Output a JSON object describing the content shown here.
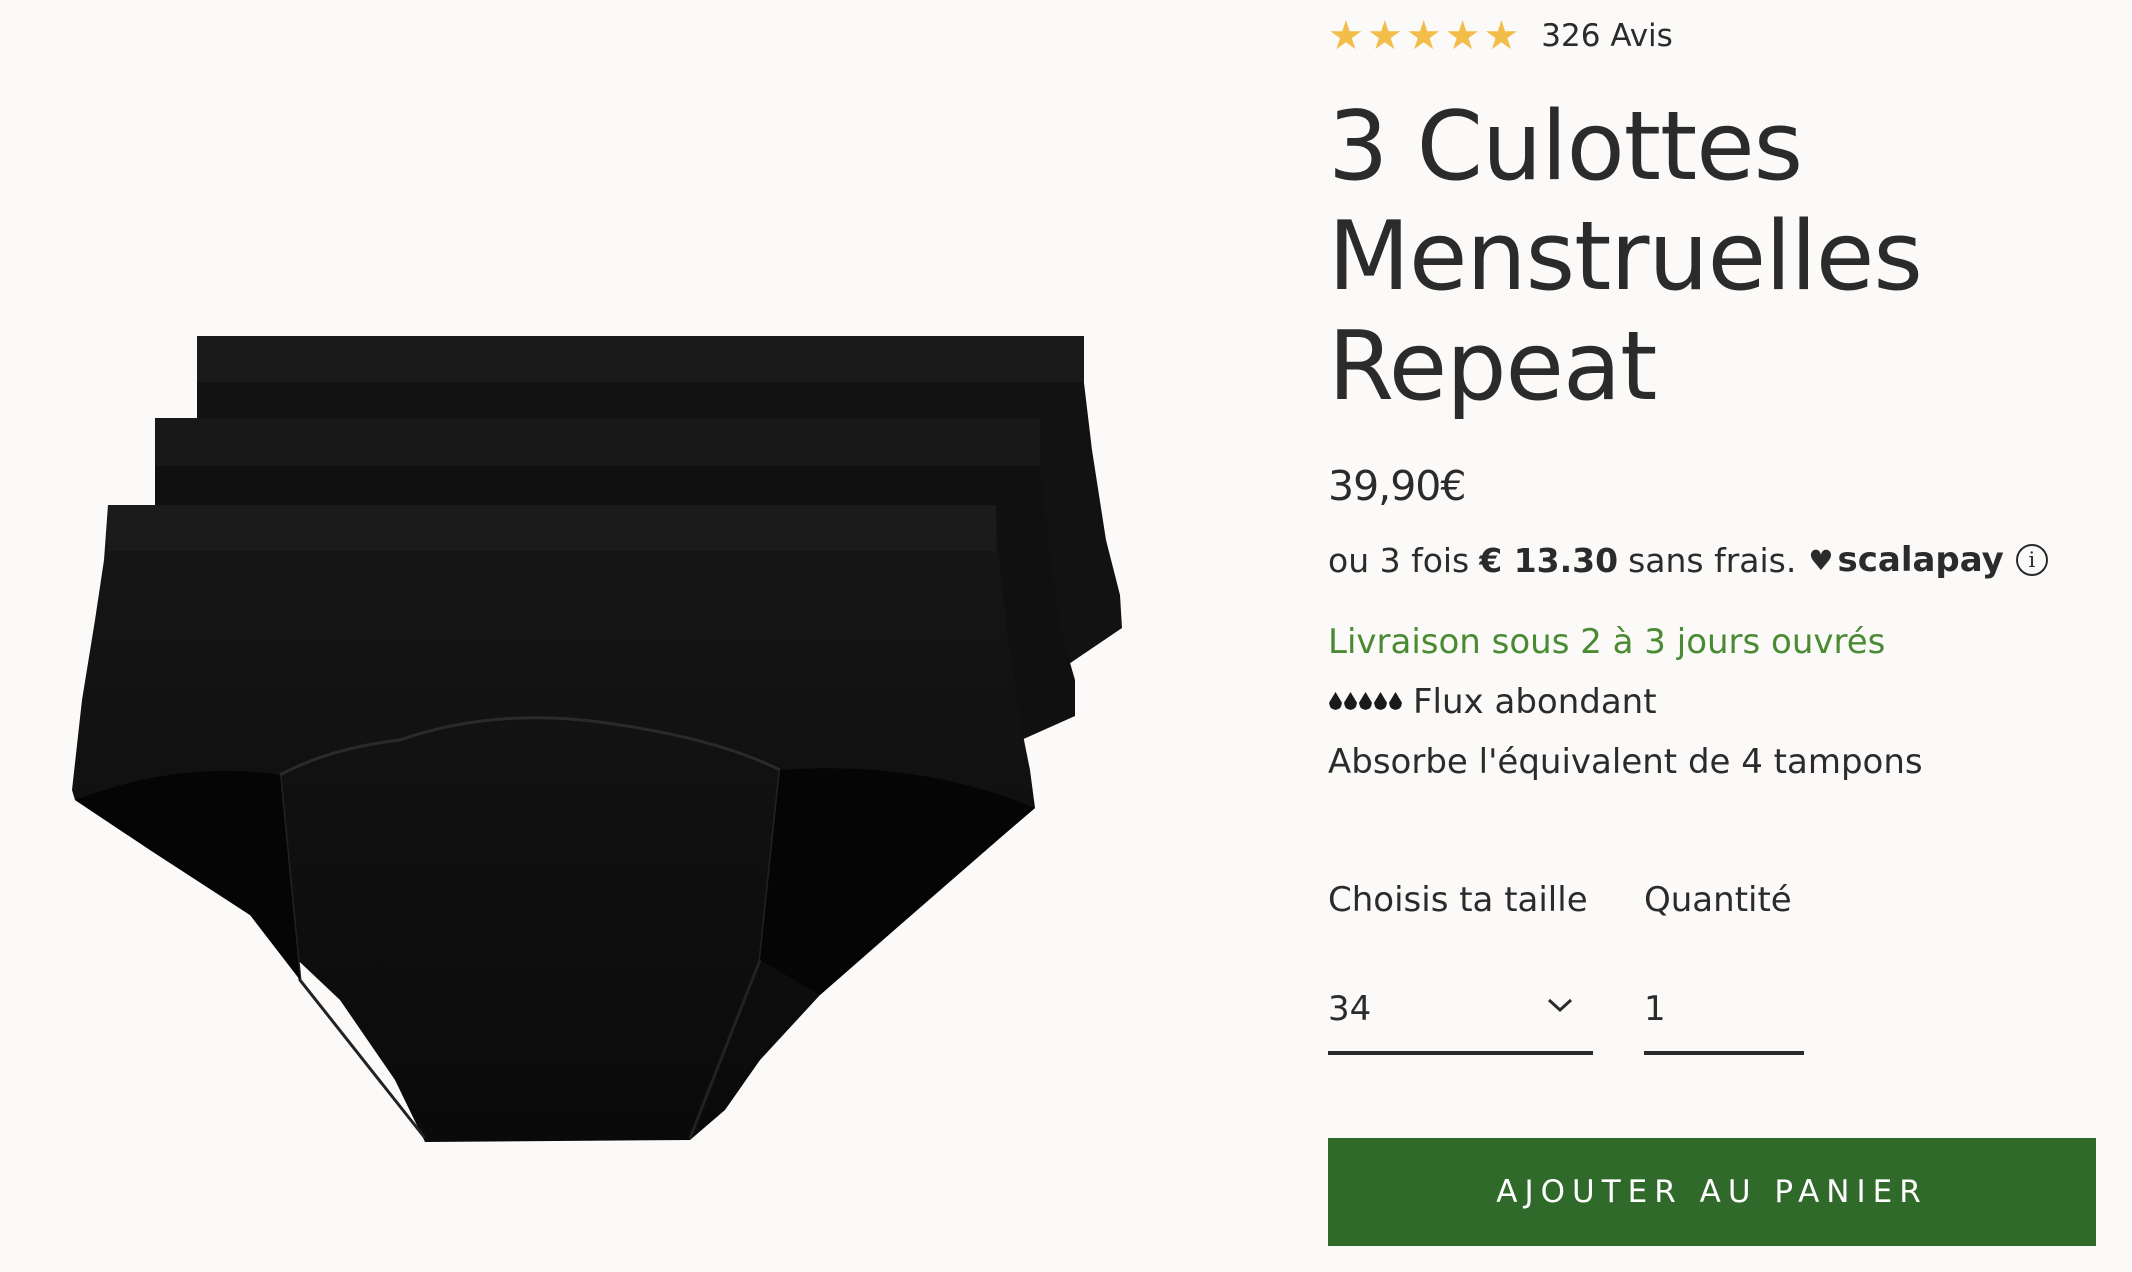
{
  "product": {
    "rating": {
      "stars": 5,
      "reviews_label": "326 Avis",
      "star_color": "#f2bd49"
    },
    "title": "3 Culottes Menstruelles Repeat",
    "price": "39,90€",
    "installments": {
      "prefix": "ou 3 fois",
      "amount": "€ 13.30",
      "suffix": "sans frais.",
      "provider": "scalapay",
      "provider_icon": "heart-icon",
      "info_icon": "info-icon"
    },
    "delivery": "Livraison sous 2 à 3 jours ouvrés",
    "delivery_color": "#4a8a32",
    "flow": {
      "drops": 5,
      "drops_icon": "drop-icon",
      "label": "Flux abondant"
    },
    "absorbency": "Absorbe l'équivalent de 4 tampons",
    "size": {
      "label": "Choisis ta taille",
      "selected": "34"
    },
    "quantity": {
      "label": "Quantité",
      "value": "1"
    },
    "add_to_cart": "AJOUTER AU PANIER",
    "button_color": "#2f6a2a"
  }
}
